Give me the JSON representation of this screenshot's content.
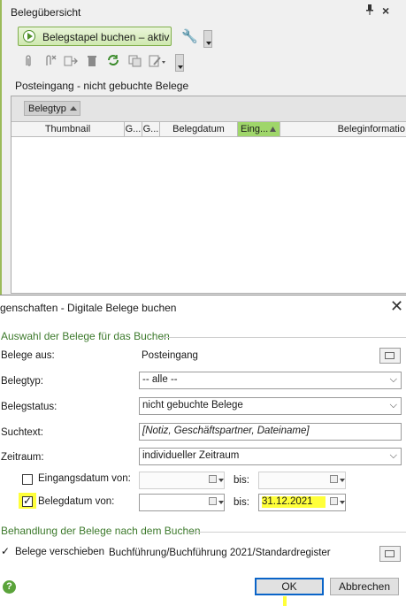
{
  "pane": {
    "title": "Belegübersicht",
    "pin_icon": "pin-icon",
    "close_label": "×",
    "book_button_label": "Belegstapel buchen – aktiv",
    "toolbar_icons": [
      "paperclip-icon",
      "detach-icon",
      "move-icon",
      "trash-icon",
      "refresh-icon",
      "copy-icon",
      "edit-icon"
    ],
    "inbox_label": "Posteingang - nicht gebuchte Belege",
    "group_chip": "Belegtyp",
    "columns": [
      "Thumbnail",
      "G...",
      "G...",
      "Belegdatum",
      "Eing...",
      "Beleginformatio"
    ],
    "accent": "#9fd66a"
  },
  "dialog": {
    "title": "genschaften - Digitale Belege buchen",
    "close_label": "✕",
    "section1": "Auswahl der Belege für das Buchen",
    "rows": {
      "belege_aus": {
        "label": "Belege aus:",
        "value": "Posteingang"
      },
      "belegtyp": {
        "label": "Belegtyp:",
        "value": "-- alle --"
      },
      "belegstatus": {
        "label": "Belegstatus:",
        "value": "nicht gebuchte Belege"
      },
      "suchtext": {
        "label": "Suchtext:",
        "placeholder": "[Notiz, Geschäftspartner, Dateiname]"
      },
      "zeitraum": {
        "label": "Zeitraum:",
        "value": "individueller Zeitraum"
      },
      "eingangsdatum": {
        "label": "Eingangsdatum von:",
        "bis": "bis:",
        "checked": false
      },
      "belegdatum": {
        "label": "Belegdatum von:",
        "bis": "bis:",
        "to_value": "31.12.2021",
        "checked": true
      }
    },
    "section2": "Behandlung der Belege nach dem Buchen",
    "move": {
      "label": "Belege verschieben",
      "path": "Buchführung/Buchführung 2021/Standardregister",
      "checked": true
    },
    "help_label": "?",
    "ok_label": "OK",
    "cancel_label": "Abbrechen",
    "highlight_color": "#ffff3a"
  }
}
